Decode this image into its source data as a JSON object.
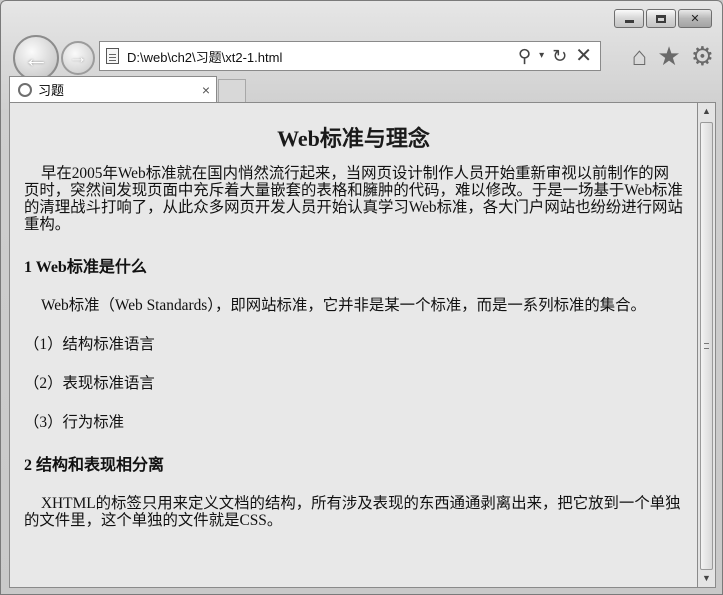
{
  "window": {
    "tab_title": "习题",
    "tab_close": "×",
    "address": "D:\\web\\ch2\\习题\\xt2-1.html"
  },
  "icons": {
    "back": "back-arrow-icon",
    "forward": "forward-arrow-icon",
    "page": "page-icon",
    "search": "search-icon",
    "dropdown": "dropdown-icon",
    "refresh": "refresh-icon",
    "stop": "close-icon",
    "home": "home-icon",
    "favorites": "star-icon",
    "settings": "gear-icon"
  },
  "document": {
    "title": "Web标准与理念",
    "intro": "早在2005年Web标准就在国内悄然流行起来，当网页设计制作人员开始重新审视以前制作的网页时，突然间发现页面中充斥着大量嵌套的表格和臃肿的代码，难以修改。于是一场基于Web标准的清理战斗打响了，从此众多网页开发人员开始认真学习Web标准，各大门户网站也纷纷进行网站重构。",
    "section1": {
      "heading": "1  Web标准是什么",
      "text": "Web标准（Web Standards），即网站标准，它并非是某一个标准，而是一系列标准的集合。",
      "items": [
        "（1）结构标准语言",
        "（2）表现标准语言",
        "（3）行为标准"
      ]
    },
    "section2": {
      "heading": "2  结构和表现相分离",
      "text": "XHTML的标签只用来定义文档的结构，所有涉及表现的东西通通剥离出来，把它放到一个单独的文件里，这个单独的文件就是CSS。"
    }
  }
}
